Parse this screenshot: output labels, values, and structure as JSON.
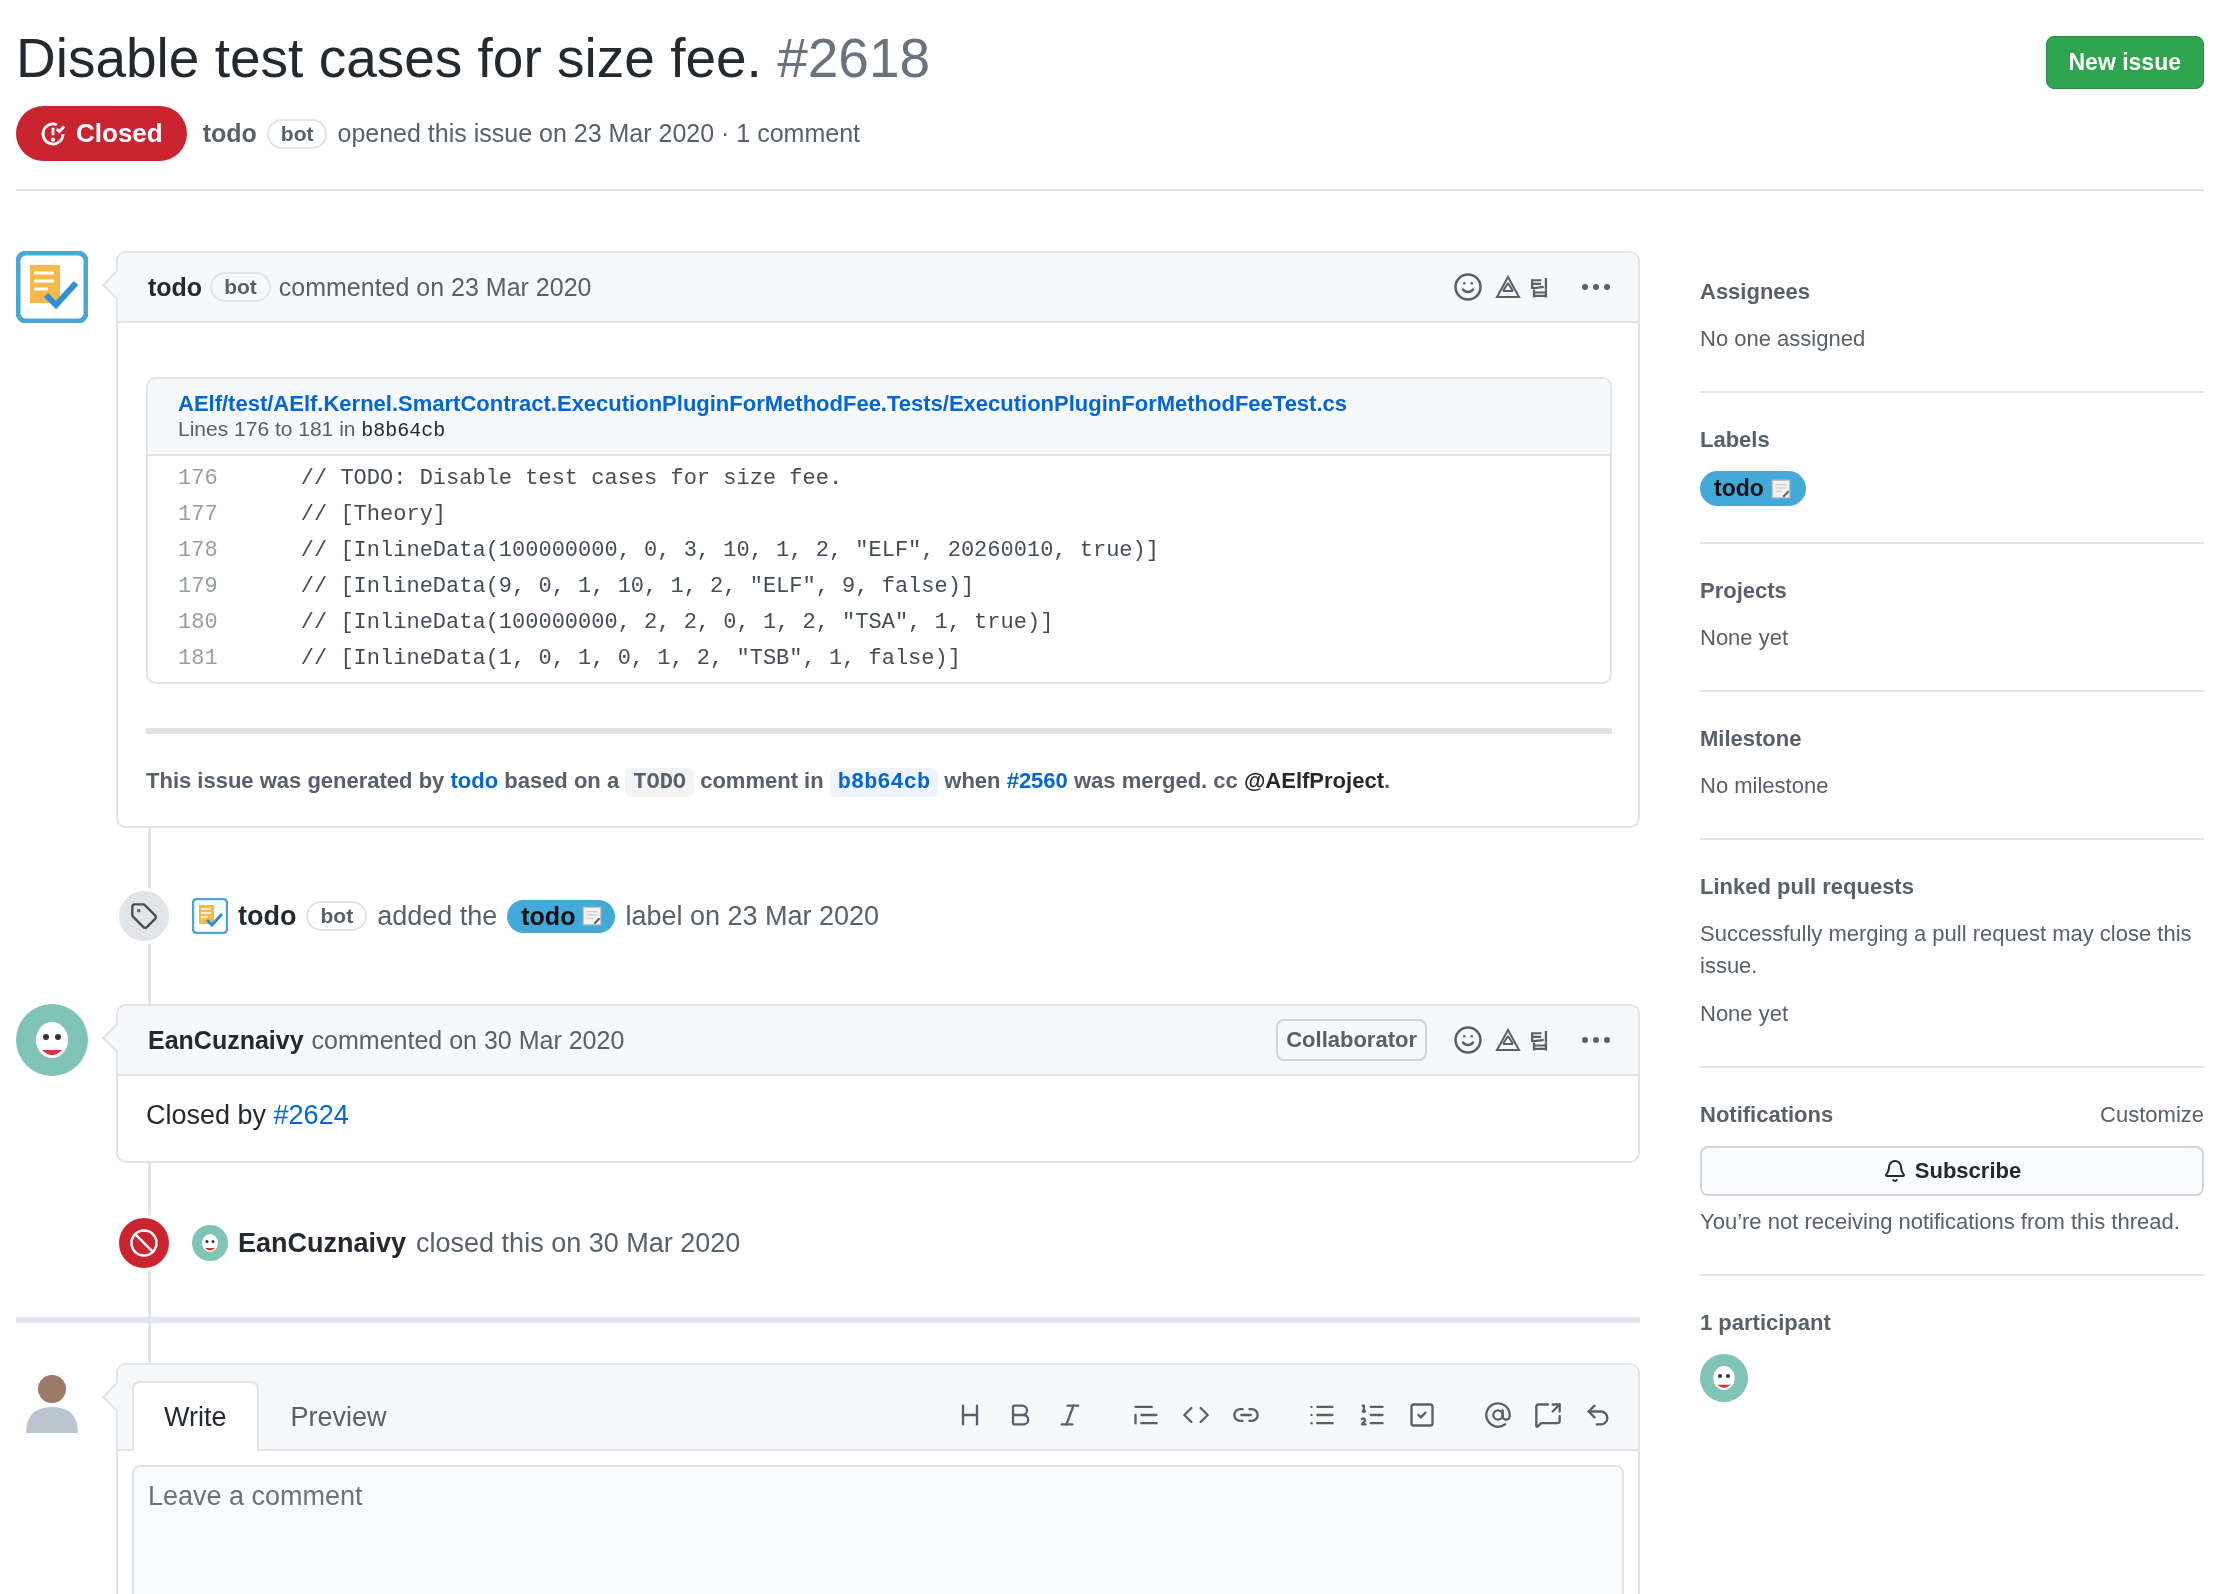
{
  "header": {
    "title": "Disable test cases for size fee.",
    "number": "#2618",
    "state": {
      "kind": "closed",
      "label": "Closed"
    },
    "author": "todo",
    "author_badge": "bot",
    "meta": "opened this issue on 23 Mar 2020 · 1 comment",
    "new_issue_button": "New issue"
  },
  "timeline": [
    {
      "kind": "comment",
      "author": "todo",
      "author_badge": "bot",
      "action": "commented on 23 Mar 2020",
      "extension_text": "팁",
      "snippet": {
        "path": "AElf/test/AElf.Kernel.SmartContract.ExecutionPluginForMethodFee.Tests/ExecutionPluginForMethodFeeTest.cs",
        "lines_text": "Lines 176 to 181 in",
        "commit": "b8b64cb",
        "lines": [
          {
            "number": "176",
            "code": "    // TODO: Disable test cases for size fee."
          },
          {
            "number": "177",
            "code": "    // [Theory]"
          },
          {
            "number": "178",
            "code": "    // [InlineData(100000000, 0, 3, 10, 1, 2, \"ELF\", 20260010, true)]"
          },
          {
            "number": "179",
            "code": "    // [InlineData(9, 0, 1, 10, 1, 2, \"ELF\", 9, false)]"
          },
          {
            "number": "180",
            "code": "    // [InlineData(100000000, 2, 2, 0, 1, 2, \"TSA\", 1, true)]"
          },
          {
            "number": "181",
            "code": "    // [InlineData(1, 0, 1, 0, 1, 2, \"TSB\", 1, false)]"
          }
        ]
      },
      "footer": [
        {
          "kind": "text",
          "text": "This issue was generated by "
        },
        {
          "kind": "link",
          "text": "todo"
        },
        {
          "kind": "text",
          "text": " based on a "
        },
        {
          "kind": "code",
          "text": "TODO"
        },
        {
          "kind": "text",
          "text": " comment in "
        },
        {
          "kind": "code-link",
          "text": "b8b64cb"
        },
        {
          "kind": "text",
          "text": " when "
        },
        {
          "kind": "link",
          "text": "#2560"
        },
        {
          "kind": "text",
          "text": " was merged. cc "
        },
        {
          "kind": "mention",
          "text": "@AElfProject"
        },
        {
          "kind": "text",
          "text": "."
        }
      ]
    },
    {
      "kind": "labeled",
      "actor": "todo",
      "actor_badge": "bot",
      "before": "added the",
      "label": "todo",
      "after": "label on 23 Mar 2020"
    },
    {
      "kind": "comment",
      "author": "EanCuznaivy",
      "role": "Collaborator",
      "action": "commented on 30 Mar 2020",
      "extension_text": "팁",
      "body": [
        {
          "kind": "text",
          "text": "Closed by "
        },
        {
          "kind": "link",
          "text": "#2624"
        }
      ]
    },
    {
      "kind": "closed",
      "actor": "EanCuznaivy",
      "text": "closed this on 30 Mar 2020"
    }
  ],
  "editor": {
    "tabs": [
      {
        "label": "Write",
        "selected": true
      },
      {
        "label": "Preview",
        "selected": false
      }
    ],
    "placeholder": "Leave a comment"
  },
  "sidebar": [
    {
      "kind": "text",
      "heading": "Assignees",
      "value": "No one assigned"
    },
    {
      "kind": "labels",
      "heading": "Labels",
      "labels": [
        "todo"
      ]
    },
    {
      "kind": "text",
      "heading": "Projects",
      "value": "None yet"
    },
    {
      "kind": "text",
      "heading": "Milestone",
      "value": "No milestone"
    },
    {
      "kind": "linked",
      "heading": "Linked pull requests",
      "note": "Successfully merging a pull request may close this issue.",
      "value": "None yet"
    },
    {
      "kind": "notifications",
      "heading": "Notifications",
      "action": "Customize",
      "button": "Subscribe",
      "note": "You’re not receiving notifications from this thread."
    },
    {
      "kind": "participants",
      "heading": "1 participant"
    }
  ]
}
